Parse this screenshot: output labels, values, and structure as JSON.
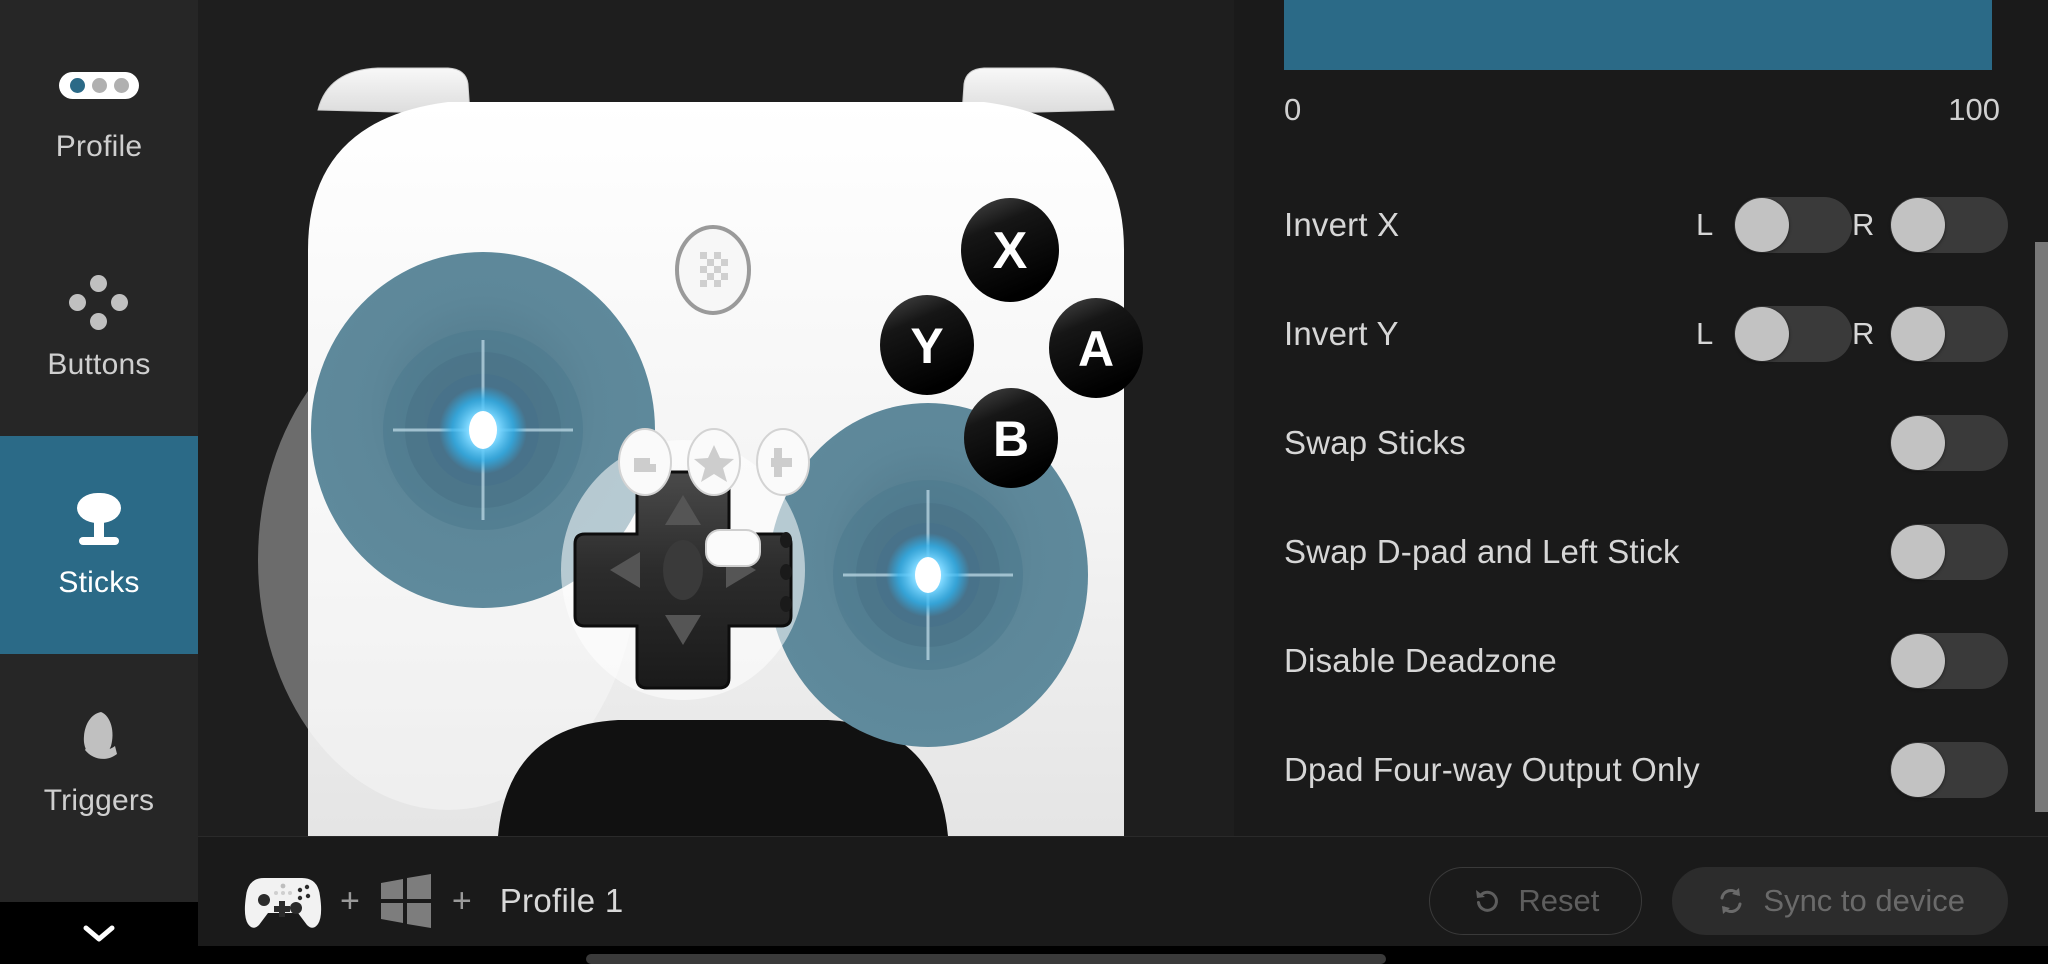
{
  "app": {
    "accent_color": "#2b6a87",
    "background": "#1a1a1a",
    "panel_background": "#1e1e1e",
    "sidebar_background": "#262626"
  },
  "sidebar": {
    "items": [
      {
        "label": "Profile",
        "icon": "profile-dots-icon",
        "active": false
      },
      {
        "label": "Buttons",
        "icon": "buttons-diamond-icon",
        "active": false
      },
      {
        "label": "Sticks",
        "icon": "thumbstick-icon",
        "active": true
      },
      {
        "label": "Triggers",
        "icon": "trigger-icon",
        "active": false
      }
    ],
    "collapse": {
      "icon": "chevron-down-icon"
    }
  },
  "controller": {
    "name": "gamepad-preview",
    "body_color": "#f1f1f1",
    "stick_highlight_color": "#5c8497",
    "stick_center_glow": "#3dc4ff",
    "face_buttons": [
      "X",
      "Y",
      "A",
      "B"
    ],
    "dpad": "dpad",
    "center_buttons": [
      "select-button",
      "home-star-button",
      "start-button"
    ],
    "home_button": "home-button",
    "small_button": "capture-button"
  },
  "settings": {
    "slider": {
      "name": "deadzone-slider",
      "value": 100,
      "min_label": "0",
      "max_label": "100",
      "fill_color": "#2b6a87"
    },
    "rows": [
      {
        "label": "Invert X",
        "type": "lr",
        "left": {
          "letter": "L",
          "on": false
        },
        "right": {
          "letter": "R",
          "on": false
        }
      },
      {
        "label": "Invert Y",
        "type": "lr",
        "left": {
          "letter": "L",
          "on": false
        },
        "right": {
          "letter": "R",
          "on": false
        }
      },
      {
        "label": "Swap Sticks",
        "type": "single",
        "on": false
      },
      {
        "label": "Swap D-pad and Left Stick",
        "type": "single",
        "on": false
      },
      {
        "label": "Disable Deadzone",
        "type": "single",
        "on": false
      },
      {
        "label": "Dpad Four-way Output Only",
        "type": "single",
        "on": false
      }
    ]
  },
  "bottombar": {
    "device_icon": "gamepad-icon",
    "plus1": "+",
    "platform_icon": "windows-icon",
    "plus2": "+",
    "profile_label": "Profile 1",
    "reset": {
      "label": "Reset",
      "icon": "undo-icon",
      "disabled": true
    },
    "sync": {
      "label": "Sync to device",
      "icon": "sync-icon",
      "disabled": true
    }
  }
}
